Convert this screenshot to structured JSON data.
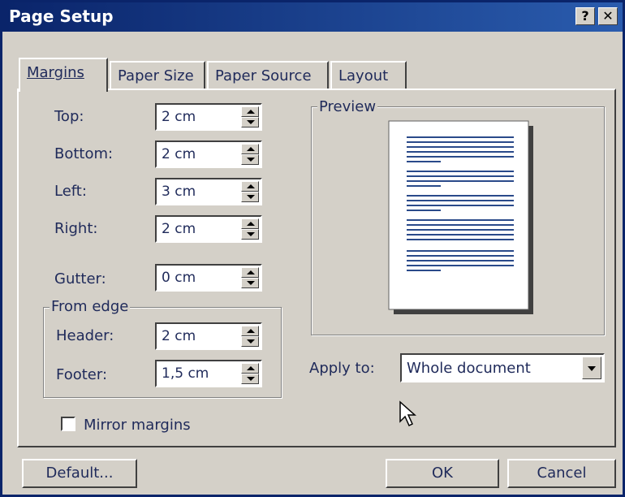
{
  "window": {
    "title": "Page Setup",
    "help_label": "?",
    "close_label": "✕"
  },
  "tabs": [
    {
      "label": "Margins"
    },
    {
      "label": "Paper Size"
    },
    {
      "label": "Paper Source"
    },
    {
      "label": "Layout"
    }
  ],
  "margins": {
    "top": {
      "label": "Top:",
      "value": "2 cm"
    },
    "bottom": {
      "label": "Bottom:",
      "value": "2 cm"
    },
    "left": {
      "label": "Left:",
      "value": "3 cm"
    },
    "right": {
      "label": "Right:",
      "value": "2 cm"
    },
    "gutter": {
      "label": "Gutter:",
      "value": "0 cm"
    }
  },
  "from_edge": {
    "title": "From edge",
    "header": {
      "label": "Header:",
      "value": "2 cm"
    },
    "footer": {
      "label": "Footer:",
      "value": "1,5 cm"
    }
  },
  "mirror_margins": {
    "label": "Mirror margins",
    "checked": false
  },
  "preview": {
    "title": "Preview"
  },
  "apply_to": {
    "label": "Apply to:",
    "value": "Whole document"
  },
  "buttons": {
    "default": "Default...",
    "ok": "OK",
    "cancel": "Cancel"
  }
}
